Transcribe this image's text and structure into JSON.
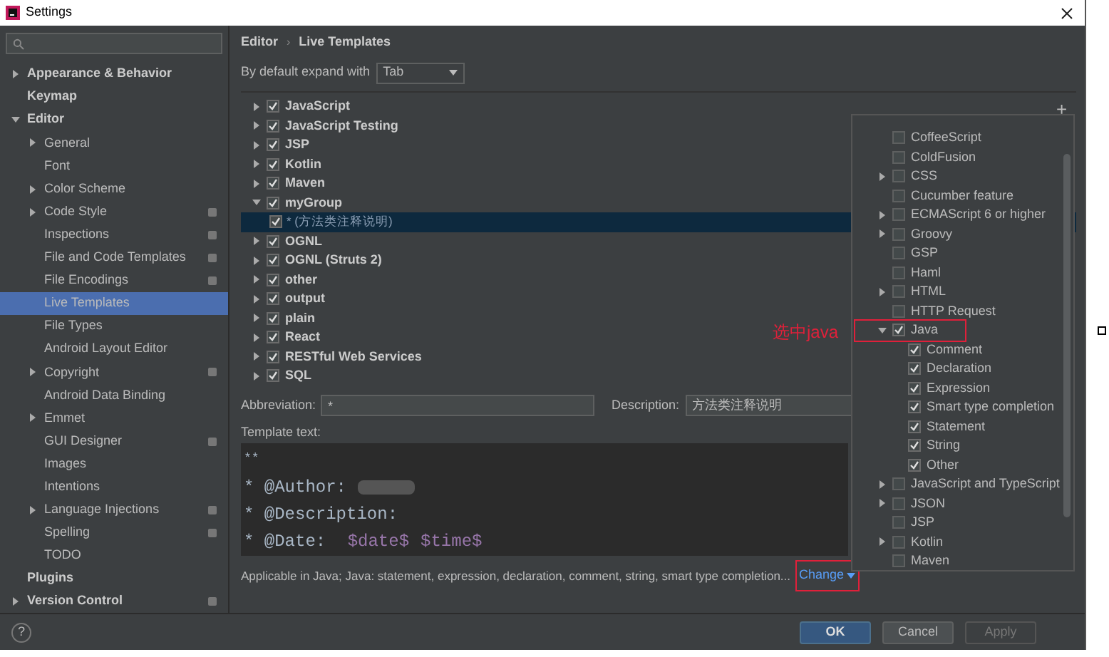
{
  "window": {
    "title": "Settings"
  },
  "sidebar": {
    "items": [
      {
        "label": "Appearance & Behavior",
        "expanded": false,
        "selected": false
      },
      {
        "label": "Keymap",
        "selected": false
      },
      {
        "label": "Editor",
        "expanded": true,
        "selected": false,
        "children": [
          {
            "label": "General",
            "expanded": false,
            "selected": false
          },
          {
            "label": "Font",
            "selected": false
          },
          {
            "label": "Color Scheme",
            "expanded": false,
            "selected": false
          },
          {
            "label": "Code Style",
            "expanded": false,
            "selected": false,
            "project_level": true
          },
          {
            "label": "Inspections",
            "selected": false,
            "project_level": true
          },
          {
            "label": "File and Code Templates",
            "selected": false,
            "project_level": true
          },
          {
            "label": "File Encodings",
            "selected": false,
            "project_level": true
          },
          {
            "label": "Live Templates",
            "selected": true
          },
          {
            "label": "File Types",
            "selected": false
          },
          {
            "label": "Android Layout Editor",
            "selected": false
          },
          {
            "label": "Copyright",
            "expanded": false,
            "selected": false,
            "project_level": true
          },
          {
            "label": "Android Data Binding",
            "selected": false
          },
          {
            "label": "Emmet",
            "expanded": false,
            "selected": false
          },
          {
            "label": "GUI Designer",
            "selected": false,
            "project_level": true
          },
          {
            "label": "Images",
            "selected": false
          },
          {
            "label": "Intentions",
            "selected": false
          },
          {
            "label": "Language Injections",
            "expanded": false,
            "selected": false,
            "project_level": true
          },
          {
            "label": "Spelling",
            "selected": false,
            "project_level": true
          },
          {
            "label": "TODO",
            "selected": false
          }
        ]
      },
      {
        "label": "Plugins",
        "selected": false
      },
      {
        "label": "Version Control",
        "expanded": false,
        "selected": false,
        "project_level": true
      }
    ]
  },
  "breadcrumb": [
    "Editor",
    "Live Templates"
  ],
  "breadcrumb_separator": "›",
  "add_button": "+",
  "expand_with": {
    "label": "By default expand with",
    "value": "Tab"
  },
  "template_groups": [
    {
      "label": "JavaScript",
      "checked": true,
      "expanded": false
    },
    {
      "label": "JavaScript Testing",
      "checked": true,
      "expanded": false
    },
    {
      "label": "JSP",
      "checked": true,
      "expanded": false
    },
    {
      "label": "Kotlin",
      "checked": true,
      "expanded": false
    },
    {
      "label": "Maven",
      "checked": true,
      "expanded": false
    },
    {
      "label": "myGroup",
      "checked": true,
      "expanded": true,
      "children": [
        {
          "label": "* (方法类注释说明)",
          "checked": true,
          "selected": true
        }
      ]
    },
    {
      "label": "OGNL",
      "checked": true,
      "expanded": false
    },
    {
      "label": "OGNL (Struts 2)",
      "checked": true,
      "expanded": false
    },
    {
      "label": "other",
      "checked": true,
      "expanded": false
    },
    {
      "label": "output",
      "checked": true,
      "expanded": false
    },
    {
      "label": "plain",
      "checked": true,
      "expanded": false
    },
    {
      "label": "React",
      "checked": true,
      "expanded": false
    },
    {
      "label": "RESTful Web Services",
      "checked": true,
      "expanded": false
    },
    {
      "label": "SQL",
      "checked": true,
      "expanded": false
    }
  ],
  "abbreviation": {
    "label": "Abbreviation:",
    "value": "*"
  },
  "description": {
    "label": "Description:",
    "value": "方法类注释说明"
  },
  "template_text": {
    "label": "Template text:",
    "lines": [
      [
        {
          "text": "**",
          "kind": "plain"
        }
      ],
      [
        {
          "text": "* @Author:",
          "kind": "plain"
        },
        {
          "kind": "redacted"
        }
      ],
      [
        {
          "text": "* @Description:",
          "kind": "plain"
        }
      ],
      [
        {
          "text": "* @Date: ",
          "kind": "plain"
        },
        {
          "text": "$date$",
          "kind": "variable"
        },
        {
          "text": "$time$",
          "kind": "variable"
        }
      ]
    ]
  },
  "applicable": {
    "text": "Applicable in Java; Java: statement, expression, declaration, comment, string, smart type completion...",
    "link": "Change"
  },
  "context_popup": {
    "items": [
      {
        "label": "CoffeeScript",
        "checked": false
      },
      {
        "label": "ColdFusion",
        "checked": false
      },
      {
        "label": "CSS",
        "checked": false,
        "expanded": false
      },
      {
        "label": "Cucumber feature",
        "checked": false
      },
      {
        "label": "ECMAScript 6 or higher",
        "checked": false,
        "expanded": false
      },
      {
        "label": "Groovy",
        "checked": false,
        "expanded": false
      },
      {
        "label": "GSP",
        "checked": false
      },
      {
        "label": "Haml",
        "checked": false
      },
      {
        "label": "HTML",
        "checked": false,
        "expanded": false
      },
      {
        "label": "HTTP Request",
        "checked": false
      },
      {
        "label": "Java",
        "checked": true,
        "expanded": true,
        "highlighted": true,
        "children": [
          {
            "label": "Comment",
            "checked": true
          },
          {
            "label": "Declaration",
            "checked": true
          },
          {
            "label": "Expression",
            "checked": true
          },
          {
            "label": "Smart type completion",
            "checked": true
          },
          {
            "label": "Statement",
            "checked": true
          },
          {
            "label": "String",
            "checked": true
          },
          {
            "label": "Other",
            "checked": true
          }
        ]
      },
      {
        "label": "JavaScript and TypeScript",
        "checked": false,
        "expanded": false
      },
      {
        "label": "JSON",
        "checked": false,
        "expanded": false
      },
      {
        "label": "JSP",
        "checked": false
      },
      {
        "label": "Kotlin",
        "checked": false,
        "expanded": false
      },
      {
        "label": "Maven",
        "checked": false
      }
    ]
  },
  "annotation": {
    "text": "选中java"
  },
  "buttons": [
    {
      "label": "OK",
      "kind": "default"
    },
    {
      "label": "Cancel",
      "kind": "normal"
    },
    {
      "label": "Apply",
      "kind": "disabled"
    }
  ],
  "help": {
    "label": "?"
  }
}
